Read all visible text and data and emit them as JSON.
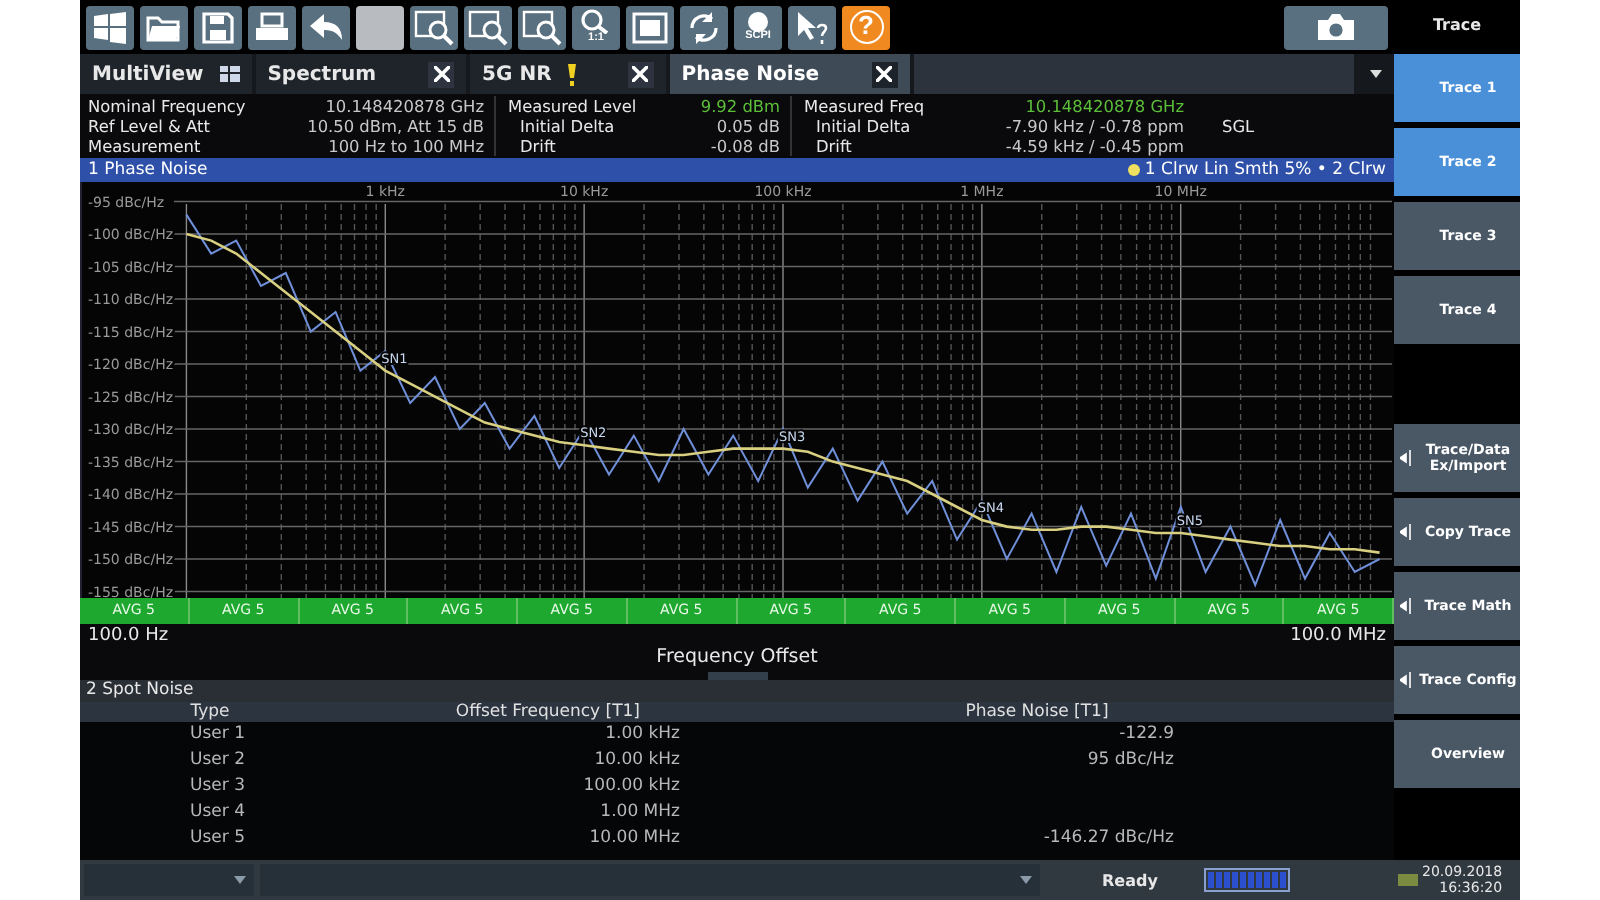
{
  "toolbar": [
    {
      "kind": "windows"
    },
    {
      "kind": "folder"
    },
    {
      "kind": "save"
    },
    {
      "kind": "print"
    },
    {
      "kind": "undo"
    },
    {
      "kind": "blank",
      "disabled": true
    },
    {
      "kind": "zoom-wave"
    },
    {
      "kind": "zoom"
    },
    {
      "kind": "zoom-window"
    },
    {
      "kind": "zoom-label",
      "label": "1:1"
    },
    {
      "kind": "fullscreen"
    },
    {
      "kind": "refresh"
    },
    {
      "kind": "dot-label",
      "label": "SCPI"
    },
    {
      "kind": "pointer-help"
    },
    {
      "kind": "help",
      "label": "?"
    }
  ],
  "tabs": [
    {
      "label": "MultiView",
      "kind": "multiview",
      "selected": false
    },
    {
      "label": "Spectrum",
      "kind": "close",
      "selected": false
    },
    {
      "label": "5G NR",
      "kind": "warning",
      "selected": false
    },
    {
      "label": "Phase Noise",
      "kind": "close",
      "selected": true
    }
  ],
  "info": [
    [
      {
        "label": "Nominal Frequency",
        "value": "10.148420878 GHz",
        "highlight": false
      },
      {
        "label": "Ref Level & Att",
        "value": "10.50 dBm, Att 15 dB",
        "highlight": false
      },
      {
        "label": "Measurement",
        "value": "100 Hz to 100 MHz",
        "highlight": false
      }
    ],
    [
      {
        "label": "Measured Level",
        "value": "9.92 dBm",
        "highlight": true
      },
      {
        "label": "Initial Delta",
        "value": "0.05 dB",
        "highlight": false
      },
      {
        "label": "Drift",
        "value": "-0.08 dB",
        "highlight": false
      }
    ],
    [
      {
        "label": "Measured Freq",
        "value": "10.148420878 GHz",
        "highlight": true
      },
      {
        "label": "Initial Delta",
        "value": "-7.90 kHz / -0.78 ppm",
        "highlight": false
      },
      {
        "label": "Drift",
        "value": "-4.59 kHz / -0.45 ppm",
        "highlight": false
      }
    ]
  ],
  "sweep_mode": "SGL",
  "phase_noise_window": {
    "title": "1 Phase Noise",
    "trace_info": "1 Clrw Lin Smth 5% • 2 Clrw",
    "chart_data": {
      "type": "line",
      "xlabel": "Frequency Offset",
      "categories": [
        null,
        null,
        null,
        null,
        null,
        null,
        null,
        null,
        "1 kHz",
        null,
        null,
        null,
        null,
        null,
        null,
        null,
        "10 kHz",
        null,
        null,
        null,
        null,
        null,
        null,
        null,
        "100 kHz",
        null,
        null,
        null,
        null,
        null,
        null,
        null,
        "1 MHz",
        null,
        null,
        null,
        null,
        null,
        null,
        null,
        "10 MHz",
        null,
        null,
        null,
        null,
        null,
        null,
        null,
        null
      ],
      "series": [
        {
          "color": "#6f8fd8",
          "values": [
            -97,
            -103,
            -101,
            -108,
            -106,
            -115,
            -112,
            -121,
            -118,
            -126,
            -122,
            -130,
            -126,
            -133,
            -128,
            -136,
            -130,
            -137,
            -131,
            -138,
            -130,
            -137,
            -131,
            -138,
            -130,
            -139,
            -133,
            -141,
            -135,
            -143,
            -138,
            -147,
            -141,
            -150,
            -143,
            -152,
            -142,
            -151,
            -143,
            -153,
            -142,
            -152,
            -145,
            -154,
            -144,
            -153,
            -146,
            -152,
            -150
          ]
        },
        {
          "color": "#d8d080",
          "values": [
            -100,
            -101,
            -103,
            -106,
            -109,
            -112,
            -115,
            -118,
            -121,
            -123,
            -125,
            -127,
            -129,
            -130,
            -131,
            -132,
            -132.5,
            -133,
            -133.5,
            -134,
            -134,
            -133.5,
            -133,
            -133,
            -133,
            -133.5,
            -135,
            -136,
            -137,
            -138,
            -140,
            -142,
            -144,
            -145,
            -145.5,
            -145.5,
            -145,
            -145,
            -145.5,
            -146,
            -146,
            -146.5,
            -147,
            -147.5,
            -148,
            -148,
            -148.5,
            -148.5,
            -149
          ]
        }
      ],
      "ylim": [
        -156,
        -92
      ],
      "grid": true,
      "yticks": [
        {
          "value": -95,
          "label": "-95 dBc/Hz"
        },
        {
          "value": -100,
          "label": "-100 dBc/Hz"
        },
        {
          "value": -105,
          "label": "-105 dBc/Hz"
        },
        {
          "value": -110,
          "label": "-110 dBc/Hz"
        },
        {
          "value": -115,
          "label": "-115 dBc/Hz"
        },
        {
          "value": -120,
          "label": "-120 dBc/Hz"
        },
        {
          "value": -125,
          "label": "-125 dBc/Hz"
        },
        {
          "value": -130,
          "label": "-130 dBc/Hz"
        },
        {
          "value": -135,
          "label": "-135 dBc/Hz"
        },
        {
          "value": -140,
          "label": "-140 dBc/Hz"
        },
        {
          "value": -145,
          "label": "-145 dBc/Hz"
        },
        {
          "value": -150,
          "label": "-150 dBc/Hz"
        },
        {
          "value": -155,
          "label": "-155 dBc/Hz"
        }
      ],
      "annotations": [
        {
          "x": "1 kHz",
          "y": -121,
          "text": "SN1"
        },
        {
          "x": "10 kHz",
          "y": -132.5,
          "text": "SN2"
        },
        {
          "x": "100 kHz",
          "y": -133,
          "text": "SN3"
        },
        {
          "x": "1 MHz",
          "y": -144,
          "text": "SN4"
        },
        {
          "x": "10 MHz",
          "y": -146,
          "text": "SN5"
        }
      ]
    },
    "avg_labels": [
      "AVG 5",
      "AVG 5",
      "AVG 5",
      "AVG 5",
      "AVG 5",
      "AVG 5",
      "AVG 5",
      "AVG 5",
      "AVG 5",
      "AVG 5",
      "AVG 5",
      "AVG 5"
    ],
    "x_start": "100.0 Hz",
    "x_stop": "100.0 MHz"
  },
  "spot_noise": {
    "title": "2 Spot Noise",
    "columns": [
      "Type",
      "Offset Frequency [T1]",
      "Phase Noise [T1]"
    ],
    "rows": [
      {
        "type": "User 1",
        "offset": "1.00 kHz",
        "phase_noise": "-122.9"
      },
      {
        "type": "User 2",
        "offset": "10.00 kHz",
        "phase_noise": "95 dBc/Hz"
      },
      {
        "type": "User 3",
        "offset": "100.00 kHz"
      },
      {
        "type": "User 4",
        "offset": "1.00 MHz"
      },
      {
        "type": "User 5",
        "offset": "10.00 MHz",
        "phase_noise": "-146.27 dBc/Hz"
      }
    ]
  },
  "status": {
    "state": "Ready",
    "date": "20.09.2018",
    "time": "16:36:20"
  },
  "side_panel": {
    "title": "Trace",
    "buttons": [
      {
        "label": "Trace 1",
        "kind": "plain",
        "active": true
      },
      {
        "label": "Trace 2",
        "kind": "plain",
        "active": true
      },
      {
        "label": "Trace 3",
        "kind": "plain",
        "active": false
      },
      {
        "label": "Trace 4",
        "kind": "plain",
        "active": false
      },
      {
        "kind": "gap"
      },
      {
        "label": "Trace/Data Ex/Import",
        "kind": "submenu",
        "active": false
      },
      {
        "label": "Copy Trace",
        "kind": "submenu",
        "active": false
      },
      {
        "label": "Trace Math",
        "kind": "submenu",
        "active": false
      },
      {
        "label": "Trace Config",
        "kind": "submenu",
        "active": false
      },
      {
        "label": "Overview",
        "kind": "plain",
        "active": false
      }
    ]
  }
}
